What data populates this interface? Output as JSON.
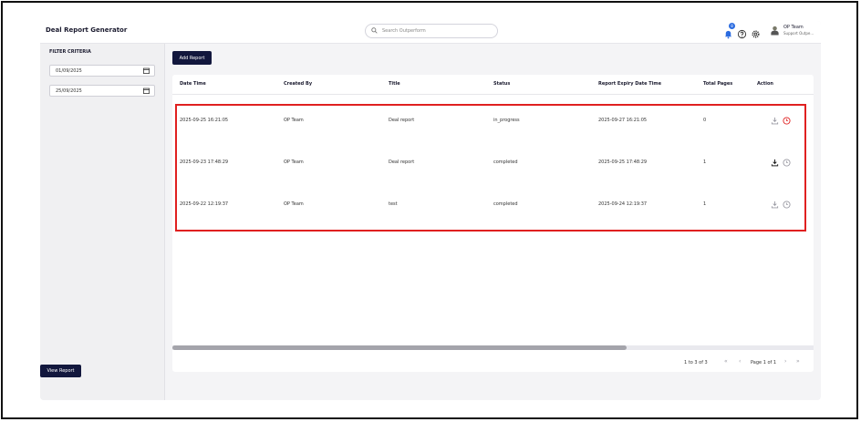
{
  "header": {
    "title": "Deal Report Generator",
    "search_placeholder": "Search Outperform",
    "notification_count": "8",
    "user_name": "OP Team",
    "user_role": "Support Outpe..."
  },
  "sidebar": {
    "filter_title": "FILTER CRITERIA",
    "start_date": "01/09/2025",
    "end_date": "25/09/2025",
    "view_report_label": "View Report"
  },
  "toolbar": {
    "add_report_label": "Add Report"
  },
  "table": {
    "columns": [
      "Date Time",
      "Created By",
      "Title",
      "Status",
      "Report Expiry Date Time",
      "Total Pages",
      "Action"
    ],
    "rows": [
      {
        "datetime": "2025-09-25 16:21:05",
        "created_by": "OP Team",
        "title": "Deal report",
        "status": "in_progress",
        "expiry": "2025-09-27 16:21:05",
        "pages": "0"
      },
      {
        "datetime": "2025-09-23 17:48:29",
        "created_by": "OP Team",
        "title": "Deal report",
        "status": "completed",
        "expiry": "2025-09-25 17:48:29",
        "pages": "1"
      },
      {
        "datetime": "2025-09-22 12:19:37",
        "created_by": "OP Team",
        "title": "test",
        "status": "completed",
        "expiry": "2025-09-24 12:19:37",
        "pages": "1"
      }
    ]
  },
  "pagination": {
    "range": "1 to 3 of 3",
    "page_label": "Page 1 of 1"
  },
  "colors": {
    "primary": "#12173d",
    "highlight": "#e02020",
    "notification": "#2a6be0"
  }
}
